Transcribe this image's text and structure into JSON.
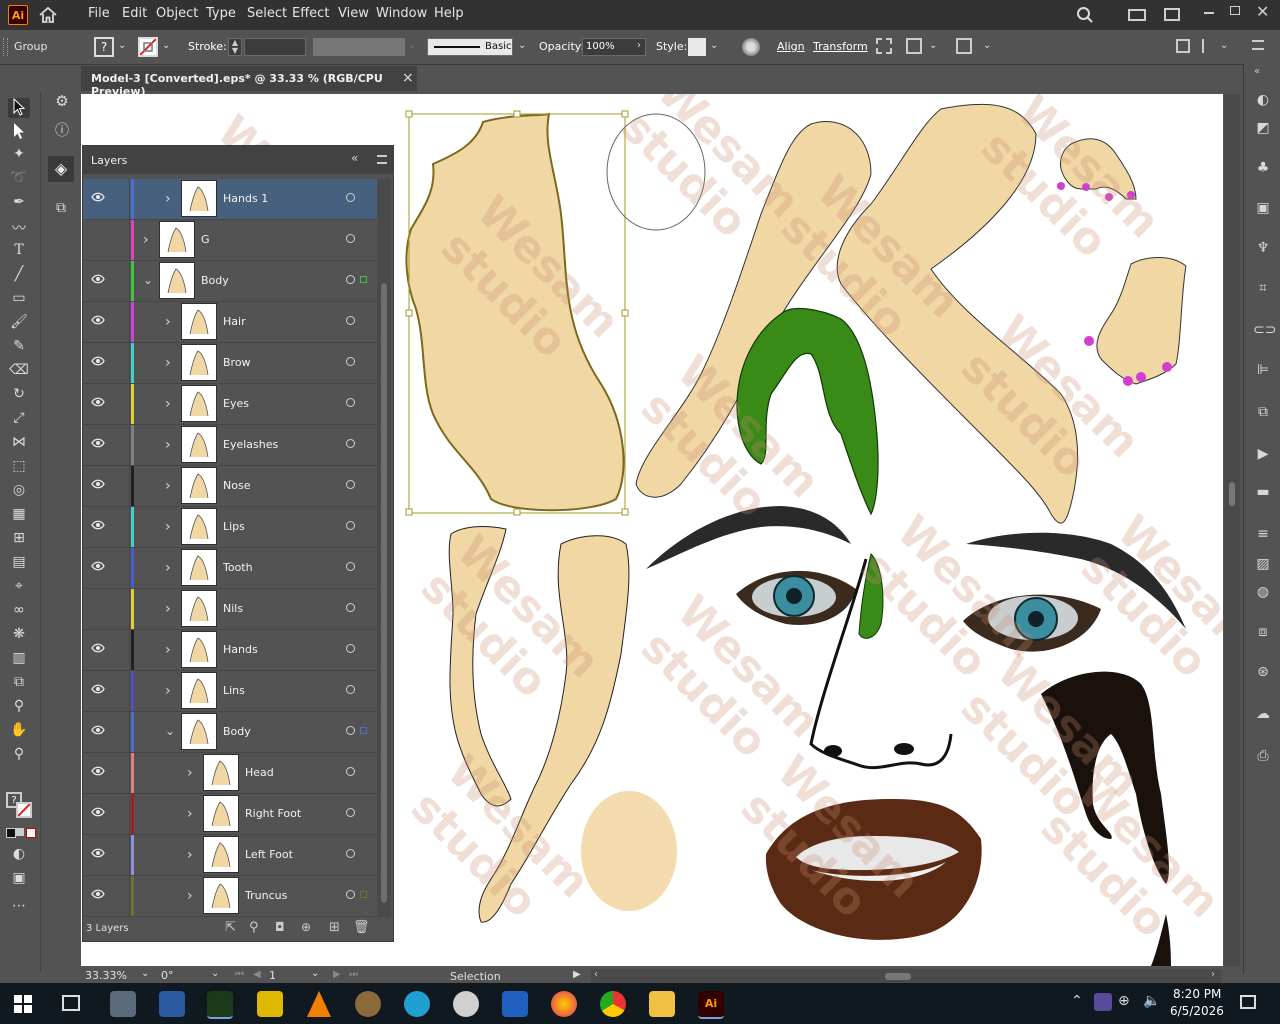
{
  "menubar": {
    "logo": "Ai",
    "items": [
      "File",
      "Edit",
      "Object",
      "Type",
      "Select",
      "Effect",
      "View",
      "Window",
      "Help"
    ]
  },
  "controlbar": {
    "object_type": "Group",
    "stroke_label": "Stroke:",
    "brush_label": "Basic",
    "opacity_label": "Opacity:",
    "opacity_value": "100%",
    "style_label": "Style:",
    "align_label": "Align",
    "transform_label": "Transform"
  },
  "document": {
    "tab_title": "Model-3 [Converted].eps* @ 33.33 % (RGB/CPU Preview)",
    "close_glyph": "×"
  },
  "layers_panel": {
    "title": "Layers",
    "footer_count": "3 Layers",
    "rows": [
      {
        "name": "Hands 1",
        "color": "#4a6fd0",
        "visible": true,
        "expanded": false,
        "indent": 1,
        "selected": true
      },
      {
        "name": "G",
        "color": "#e040c0",
        "visible": false,
        "expanded": false,
        "indent": 0,
        "selected": false
      },
      {
        "name": "Body",
        "color": "#3ec83e",
        "visible": true,
        "expanded": true,
        "indent": 0,
        "selected": false,
        "marker": "#36c836"
      },
      {
        "name": "Hair",
        "color": "#d040e0",
        "visible": true,
        "expanded": false,
        "indent": 1,
        "selected": false
      },
      {
        "name": "Brow",
        "color": "#40d0d0",
        "visible": true,
        "expanded": false,
        "indent": 1,
        "selected": false
      },
      {
        "name": "Eyes",
        "color": "#e0d030",
        "visible": true,
        "expanded": false,
        "indent": 1,
        "selected": false
      },
      {
        "name": "Eyelashes",
        "color": "#808080",
        "visible": true,
        "expanded": false,
        "indent": 1,
        "selected": false
      },
      {
        "name": "Nose",
        "color": "#202020",
        "visible": true,
        "expanded": false,
        "indent": 1,
        "selected": false
      },
      {
        "name": "Lips",
        "color": "#40d0d0",
        "visible": true,
        "expanded": false,
        "indent": 1,
        "selected": false
      },
      {
        "name": "Tooth",
        "color": "#4060d0",
        "visible": true,
        "expanded": false,
        "indent": 1,
        "selected": false
      },
      {
        "name": "Nils",
        "color": "#e0d030",
        "visible": false,
        "expanded": false,
        "indent": 1,
        "selected": false
      },
      {
        "name": "Hands",
        "color": "#202020",
        "visible": true,
        "expanded": false,
        "indent": 1,
        "selected": false
      },
      {
        "name": "Lins",
        "color": "#5050c0",
        "visible": true,
        "expanded": false,
        "indent": 1,
        "selected": false
      },
      {
        "name": "Body",
        "color": "#4a6fd0",
        "visible": true,
        "expanded": true,
        "indent": 1,
        "selected": false,
        "marker": "#4a6fd0"
      },
      {
        "name": "Head",
        "color": "#e08080",
        "visible": true,
        "expanded": false,
        "indent": 2,
        "selected": false
      },
      {
        "name": "Right Foot",
        "color": "#a02020",
        "visible": true,
        "expanded": false,
        "indent": 2,
        "selected": false
      },
      {
        "name": "Left Foot",
        "color": "#9090e0",
        "visible": true,
        "expanded": false,
        "indent": 2,
        "selected": false
      },
      {
        "name": "Truncus",
        "color": "#707030",
        "visible": true,
        "expanded": false,
        "indent": 2,
        "selected": false,
        "marker": "#707030"
      }
    ]
  },
  "statusbar": {
    "zoom": "33.33%",
    "rotation": "0°",
    "artboard": "1",
    "tool_name": "Selection"
  },
  "watermark": {
    "line1": "Wesam",
    "line2": "studio"
  },
  "taskbar": {
    "time": "8:20 PM",
    "date": "6/5/2026"
  }
}
